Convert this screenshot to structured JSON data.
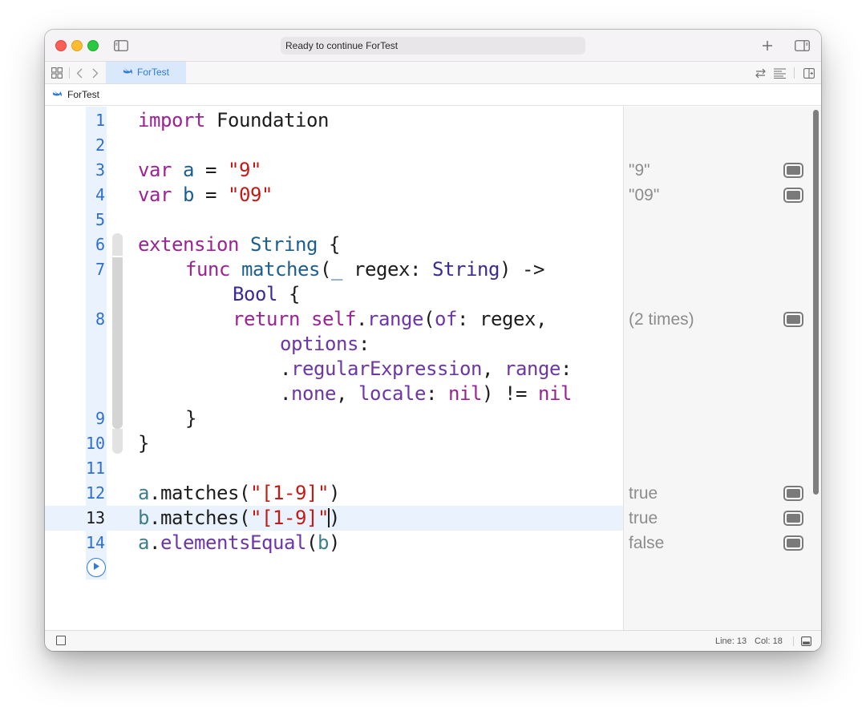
{
  "titlebar": {
    "status": "Ready to continue ForTest",
    "icons": [
      "sidebar-toggle-icon",
      "plus-icon",
      "inspector-toggle-icon"
    ]
  },
  "tabbar": {
    "tab_label": "ForTest",
    "icons": [
      "grid-icon",
      "chevron-left-icon",
      "chevron-right-icon",
      "swift-icon",
      "swap-icon",
      "lines-icon",
      "add-editor-icon"
    ]
  },
  "breadcrumb": {
    "label": "ForTest"
  },
  "editor": {
    "line_numbers": [
      "1",
      "2",
      "3",
      "4",
      "5",
      "6",
      "7",
      "8",
      "9",
      "10",
      "11",
      "12",
      "13",
      "14"
    ],
    "current_line": "13",
    "results": [
      {
        "line": "3",
        "text": "\"9\""
      },
      {
        "line": "4",
        "text": "\"09\""
      },
      {
        "line": "8",
        "text": "(2 times)"
      },
      {
        "line": "12",
        "text": "true"
      },
      {
        "line": "13",
        "text": "true"
      },
      {
        "line": "14",
        "text": "false"
      }
    ]
  },
  "statusbar": {
    "line_label": "Line: 13",
    "col_label": "Col: 18"
  },
  "colors": {
    "keyword": "#9b2393",
    "string": "#c41a16",
    "identifier": "#1c5f8f",
    "type": "#3a2b96",
    "function": "#6c36a9",
    "line_number": "#2f6fd0",
    "accent": "#2f7bd9"
  }
}
